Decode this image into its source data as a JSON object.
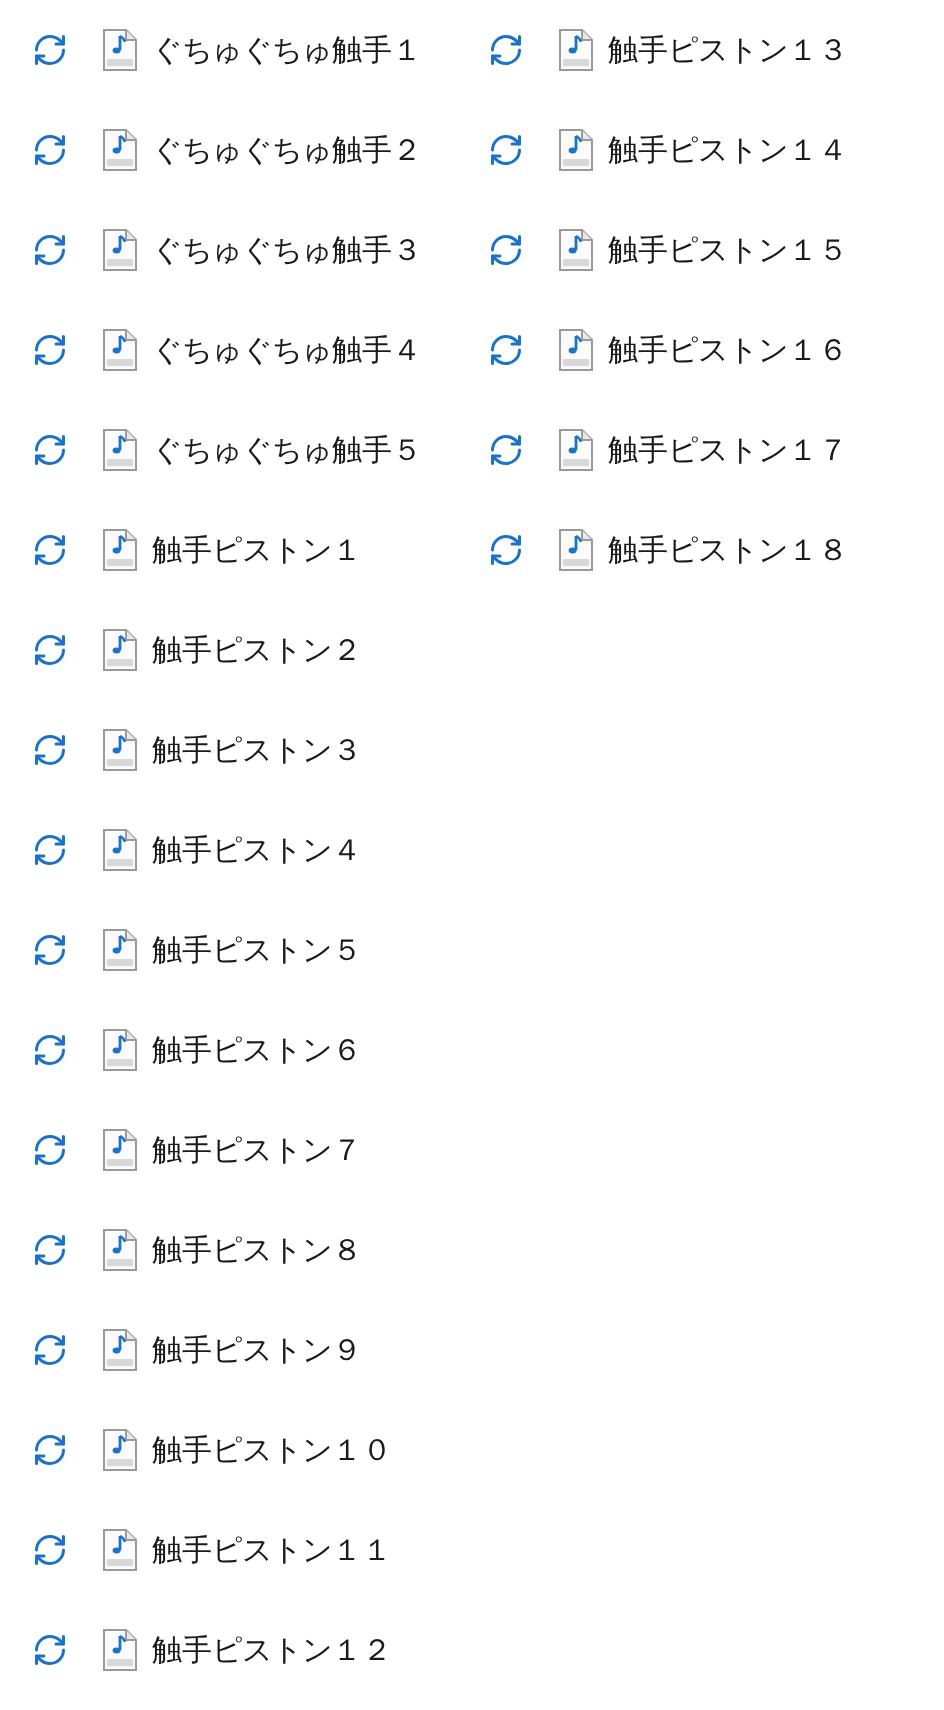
{
  "columns": [
    {
      "files": [
        {
          "name": "ぐちゅぐちゅ触手１",
          "kind": "syncing"
        },
        {
          "name": "ぐちゅぐちゅ触手２",
          "kind": "syncing"
        },
        {
          "name": "ぐちゅぐちゅ触手３",
          "kind": "syncing"
        },
        {
          "name": "ぐちゅぐちゅ触手４",
          "kind": "syncing"
        },
        {
          "name": "ぐちゅぐちゅ触手５",
          "kind": "syncing"
        },
        {
          "name": "触手ピストン１",
          "kind": "syncing"
        },
        {
          "name": "触手ピストン２",
          "kind": "syncing"
        },
        {
          "name": "触手ピストン３",
          "kind": "syncing"
        },
        {
          "name": "触手ピストン４",
          "kind": "syncing"
        },
        {
          "name": "触手ピストン５",
          "kind": "syncing"
        },
        {
          "name": "触手ピストン６",
          "kind": "syncing"
        },
        {
          "name": "触手ピストン７",
          "kind": "syncing"
        },
        {
          "name": "触手ピストン８",
          "kind": "syncing"
        },
        {
          "name": "触手ピストン９",
          "kind": "syncing"
        },
        {
          "name": "触手ピストン１０",
          "kind": "syncing"
        },
        {
          "name": "触手ピストン１１",
          "kind": "syncing"
        },
        {
          "name": "触手ピストン１２",
          "kind": "syncing"
        }
      ]
    },
    {
      "files": [
        {
          "name": "触手ピストン１３",
          "kind": "syncing"
        },
        {
          "name": "触手ピストン１４",
          "kind": "syncing"
        },
        {
          "name": "触手ピストン１５",
          "kind": "syncing"
        },
        {
          "name": "触手ピストン１６",
          "kind": "syncing"
        },
        {
          "name": "触手ピストン１７",
          "kind": "syncing"
        },
        {
          "name": "触手ピストン１８",
          "kind": "syncing"
        }
      ]
    }
  ]
}
